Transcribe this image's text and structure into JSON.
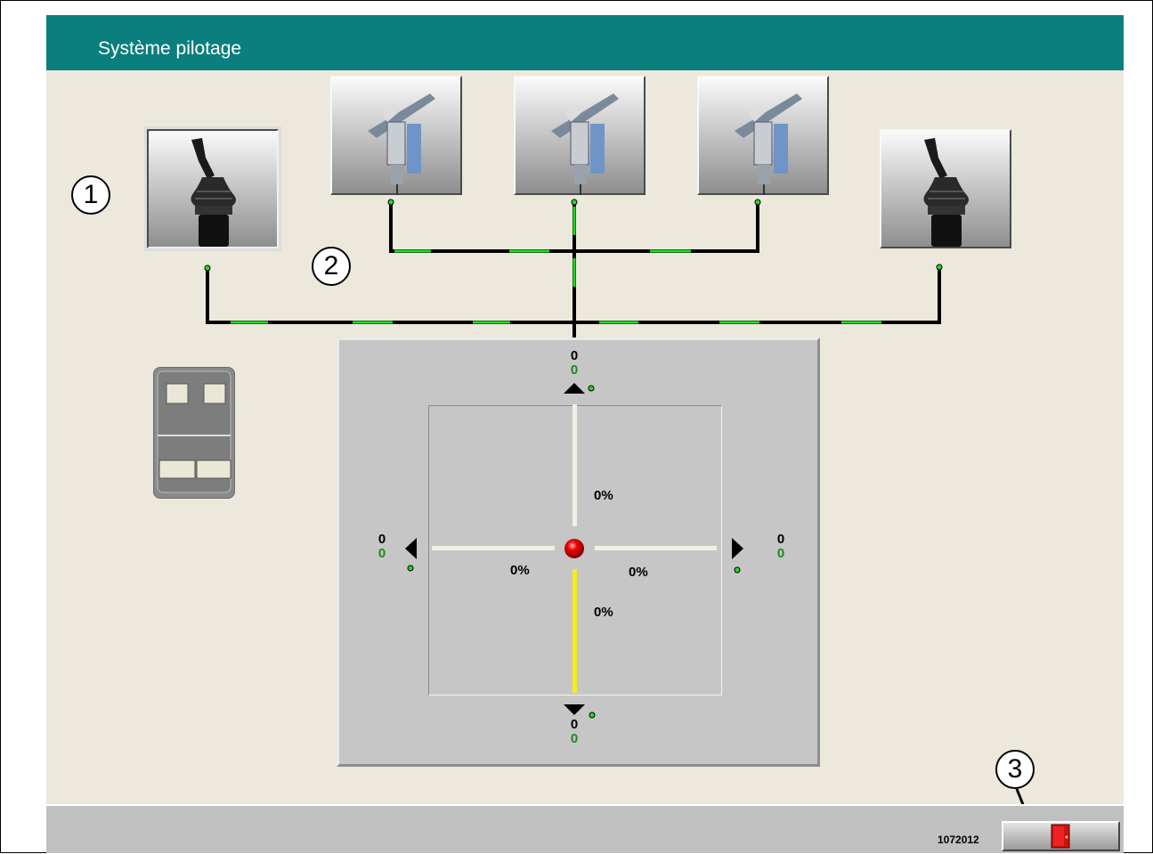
{
  "window": {
    "title": "Système pilotage"
  },
  "callouts": [
    "1",
    "2",
    "3"
  ],
  "devices": {
    "left_joystick": {
      "icon": "joystick-icon"
    },
    "valves": [
      {
        "icon": "valve-icon"
      },
      {
        "icon": "valve-icon"
      },
      {
        "icon": "valve-icon"
      }
    ],
    "right_joystick": {
      "icon": "joystick-icon"
    }
  },
  "control_pad": {
    "icon": "control-pad-icon"
  },
  "axes": {
    "up": {
      "value": "0",
      "sub": "0"
    },
    "down": {
      "value": "0",
      "sub": "0"
    },
    "left": {
      "value": "0",
      "sub": "0"
    },
    "right": {
      "value": "0",
      "sub": "0"
    }
  },
  "percentages": {
    "up": "0%",
    "down": "0%",
    "left": "0%",
    "right": "0%"
  },
  "status": {
    "serial": "1072012",
    "exit_icon": "exit-door-icon"
  },
  "colors": {
    "title_bar": "#0b7f7d",
    "background": "#ece8dc",
    "link_active": "#22dd22",
    "indicator": "#ee0000",
    "bar_active": "#f2ee1a"
  }
}
